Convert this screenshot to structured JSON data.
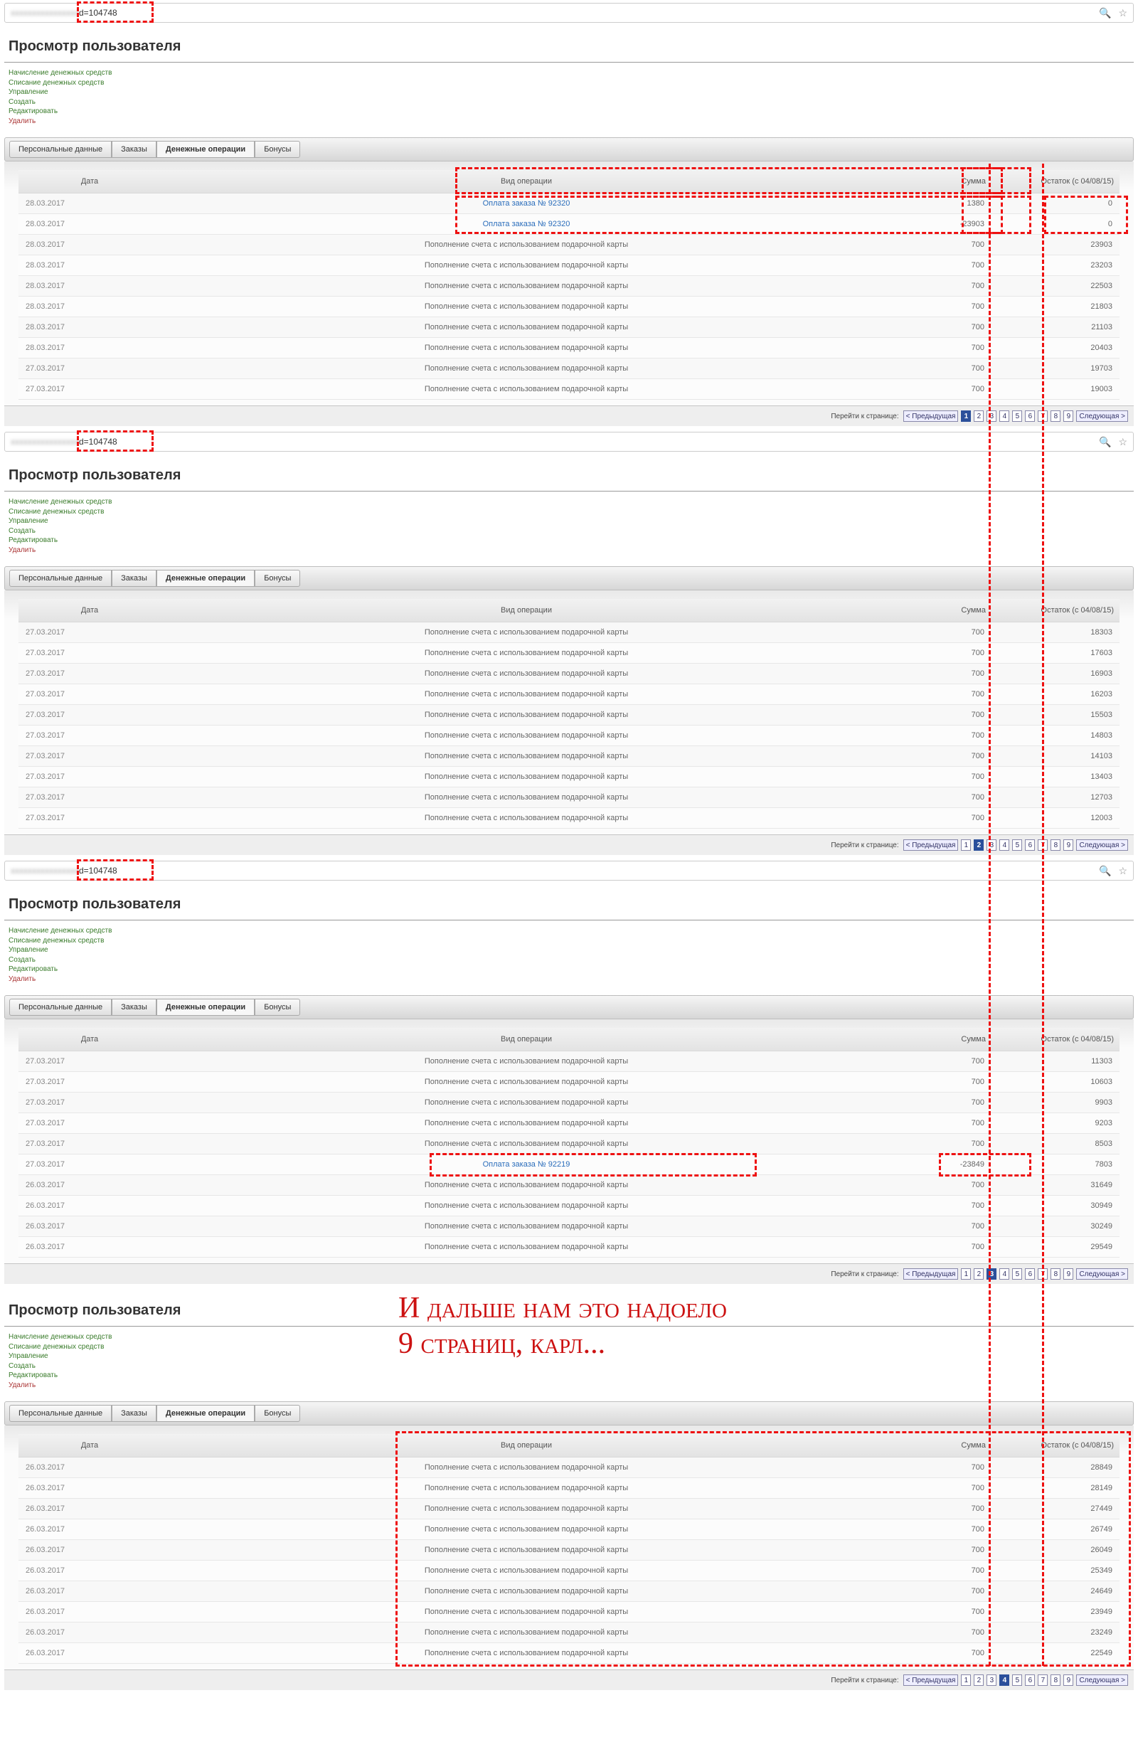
{
  "url_suffix": "d=104748",
  "page_title": "Просмотр пользователя",
  "actions": {
    "a1": "Начисление денежных средств",
    "a2": "Списание денежных средств",
    "a3": "Управление",
    "a4": "Создать",
    "a5": "Редактировать",
    "a6": "Удалить"
  },
  "tabs": {
    "t1": "Персональные данные",
    "t2": "Заказы",
    "t3": "Денежные операции",
    "t4": "Бонусы"
  },
  "cols": {
    "date": "Дата",
    "op": "Вид операции",
    "sum": "Сумма",
    "bal": "Остаток (с 04/08/15)"
  },
  "pager": {
    "label": "Перейти к странице:",
    "prev": "< Предыдущая",
    "next": "Следующая >"
  },
  "panels": [
    {
      "active_page": 1,
      "rows": [
        {
          "date": "28.03.2017",
          "op": "Оплата заказа № 92320",
          "op_link": true,
          "sum": "1380",
          "bal": "0"
        },
        {
          "date": "28.03.2017",
          "op": "Оплата заказа № 92320",
          "op_link": true,
          "sum": "-23903",
          "bal": "0"
        },
        {
          "date": "28.03.2017",
          "op": "Пополнение счета с использованием подарочной карты",
          "sum": "700",
          "bal": "23903"
        },
        {
          "date": "28.03.2017",
          "op": "Пополнение счета с использованием подарочной карты",
          "sum": "700",
          "bal": "23203"
        },
        {
          "date": "28.03.2017",
          "op": "Пополнение счета с использованием подарочной карты",
          "sum": "700",
          "bal": "22503"
        },
        {
          "date": "28.03.2017",
          "op": "Пополнение счета с использованием подарочной карты",
          "sum": "700",
          "bal": "21803"
        },
        {
          "date": "28.03.2017",
          "op": "Пополнение счета с использованием подарочной карты",
          "sum": "700",
          "bal": "21103"
        },
        {
          "date": "28.03.2017",
          "op": "Пополнение счета с использованием подарочной карты",
          "sum": "700",
          "bal": "20403"
        },
        {
          "date": "27.03.2017",
          "op": "Пополнение счета с использованием подарочной карты",
          "sum": "700",
          "bal": "19703"
        },
        {
          "date": "27.03.2017",
          "op": "Пополнение счета с использованием подарочной карты",
          "sum": "700",
          "bal": "19003"
        }
      ]
    },
    {
      "active_page": 2,
      "rows": [
        {
          "date": "27.03.2017",
          "op": "Пополнение счета с использованием подарочной карты",
          "sum": "700",
          "bal": "18303"
        },
        {
          "date": "27.03.2017",
          "op": "Пополнение счета с использованием подарочной карты",
          "sum": "700",
          "bal": "17603"
        },
        {
          "date": "27.03.2017",
          "op": "Пополнение счета с использованием подарочной карты",
          "sum": "700",
          "bal": "16903"
        },
        {
          "date": "27.03.2017",
          "op": "Пополнение счета с использованием подарочной карты",
          "sum": "700",
          "bal": "16203"
        },
        {
          "date": "27.03.2017",
          "op": "Пополнение счета с использованием подарочной карты",
          "sum": "700",
          "bal": "15503"
        },
        {
          "date": "27.03.2017",
          "op": "Пополнение счета с использованием подарочной карты",
          "sum": "700",
          "bal": "14803"
        },
        {
          "date": "27.03.2017",
          "op": "Пополнение счета с использованием подарочной карты",
          "sum": "700",
          "bal": "14103"
        },
        {
          "date": "27.03.2017",
          "op": "Пополнение счета с использованием подарочной карты",
          "sum": "700",
          "bal": "13403"
        },
        {
          "date": "27.03.2017",
          "op": "Пополнение счета с использованием подарочной карты",
          "sum": "700",
          "bal": "12703"
        },
        {
          "date": "27.03.2017",
          "op": "Пополнение счета с использованием подарочной карты",
          "sum": "700",
          "bal": "12003"
        }
      ]
    },
    {
      "active_page": 3,
      "rows": [
        {
          "date": "27.03.2017",
          "op": "Пополнение счета с использованием подарочной карты",
          "sum": "700",
          "bal": "11303"
        },
        {
          "date": "27.03.2017",
          "op": "Пополнение счета с использованием подарочной карты",
          "sum": "700",
          "bal": "10603"
        },
        {
          "date": "27.03.2017",
          "op": "Пополнение счета с использованием подарочной карты",
          "sum": "700",
          "bal": "9903"
        },
        {
          "date": "27.03.2017",
          "op": "Пополнение счета с использованием подарочной карты",
          "sum": "700",
          "bal": "9203"
        },
        {
          "date": "27.03.2017",
          "op": "Пополнение счета с использованием подарочной карты",
          "sum": "700",
          "bal": "8503"
        },
        {
          "date": "27.03.2017",
          "op": "Оплата заказа № 92219",
          "op_link": true,
          "sum": "-23849",
          "bal": "7803"
        },
        {
          "date": "26.03.2017",
          "op": "Пополнение счета с использованием подарочной карты",
          "sum": "700",
          "bal": "31649"
        },
        {
          "date": "26.03.2017",
          "op": "Пополнение счета с использованием подарочной карты",
          "sum": "700",
          "bal": "30949"
        },
        {
          "date": "26.03.2017",
          "op": "Пополнение счета с использованием подарочной карты",
          "sum": "700",
          "bal": "30249"
        },
        {
          "date": "26.03.2017",
          "op": "Пополнение счета с использованием подарочной карты",
          "sum": "700",
          "bal": "29549"
        }
      ]
    },
    {
      "active_page": 4,
      "rows": [
        {
          "date": "26.03.2017",
          "op": "Пополнение счета с использованием подарочной карты",
          "sum": "700",
          "bal": "28849"
        },
        {
          "date": "26.03.2017",
          "op": "Пополнение счета с использованием подарочной карты",
          "sum": "700",
          "bal": "28149"
        },
        {
          "date": "26.03.2017",
          "op": "Пополнение счета с использованием подарочной карты",
          "sum": "700",
          "bal": "27449"
        },
        {
          "date": "26.03.2017",
          "op": "Пополнение счета с использованием подарочной карты",
          "sum": "700",
          "bal": "26749"
        },
        {
          "date": "26.03.2017",
          "op": "Пополнение счета с использованием подарочной карты",
          "sum": "700",
          "bal": "26049"
        },
        {
          "date": "26.03.2017",
          "op": "Пополнение счета с использованием подарочной карты",
          "sum": "700",
          "bal": "25349"
        },
        {
          "date": "26.03.2017",
          "op": "Пополнение счета с использованием подарочной карты",
          "sum": "700",
          "bal": "24649"
        },
        {
          "date": "26.03.2017",
          "op": "Пополнение счета с использованием подарочной карты",
          "sum": "700",
          "bal": "23949"
        },
        {
          "date": "26.03.2017",
          "op": "Пополнение счета с использованием подарочной карты",
          "sum": "700",
          "bal": "23249"
        },
        {
          "date": "26.03.2017",
          "op": "Пополнение счета с использованием подарочной карты",
          "sum": "700",
          "bal": "22549"
        }
      ]
    }
  ],
  "annotation": {
    "line1": "И дальше нам это надоело",
    "line2": "9 страниц, карл..."
  }
}
